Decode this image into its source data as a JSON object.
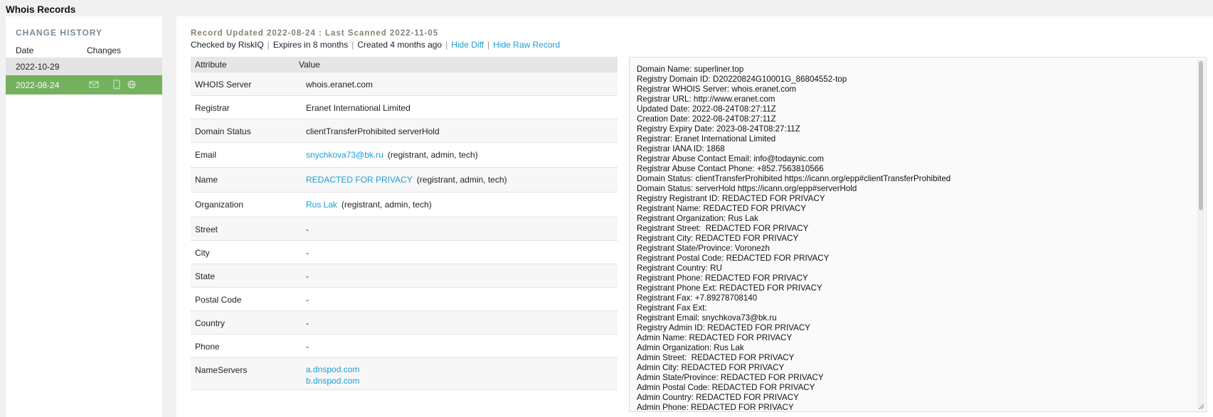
{
  "page": {
    "title": "Whois Records"
  },
  "sidebar": {
    "title": "CHANGE HISTORY",
    "col_date": "Date",
    "col_changes": "Changes",
    "rows": [
      {
        "date": "2022-10-29"
      },
      {
        "date": "2022-08-24",
        "icons": [
          "email-icon",
          "phone-icon",
          "globe-icon"
        ]
      }
    ]
  },
  "record": {
    "header": "Record Updated 2022-08-24 : Last Scanned 2022-11-05",
    "checked_by": "Checked by RiskIQ",
    "expires": "Expires in 8 months",
    "created": "Created 4 months ago",
    "hide_diff": "Hide Diff",
    "hide_raw": "Hide Raw Record"
  },
  "table": {
    "col_attribute": "Attribute",
    "col_value": "Value",
    "rows": [
      {
        "attr": "WHOIS Server",
        "value": "whois.eranet.com"
      },
      {
        "attr": "Registrar",
        "value": "Eranet International Limited"
      },
      {
        "attr": "Domain Status",
        "value": "clientTransferProhibited serverHold"
      },
      {
        "attr": "Email",
        "link": "snychkova73@bk.ru",
        "roles": "(registrant, admin, tech)"
      },
      {
        "attr": "Name",
        "link": "REDACTED FOR PRIVACY",
        "roles": "(registrant, admin, tech)"
      },
      {
        "attr": "Organization",
        "link": "Rus Lak",
        "roles": "(registrant, admin, tech)"
      },
      {
        "attr": "Street",
        "value": "-"
      },
      {
        "attr": "City",
        "value": "-"
      },
      {
        "attr": "State",
        "value": "-"
      },
      {
        "attr": "Postal Code",
        "value": "-"
      },
      {
        "attr": "Country",
        "value": "-"
      },
      {
        "attr": "Phone",
        "value": "-"
      },
      {
        "attr": "NameServers",
        "links": [
          "a.dnspod.com",
          "b.dnspod.com"
        ]
      }
    ]
  },
  "raw_record": {
    "lines": [
      "Domain Name: superliner.top",
      "Registry Domain ID: D20220824G10001G_86804552-top",
      "Registrar WHOIS Server: whois.eranet.com",
      "Registrar URL: http://www.eranet.com",
      "Updated Date: 2022-08-24T08:27:11Z",
      "Creation Date: 2022-08-24T08:27:11Z",
      "Registry Expiry Date: 2023-08-24T08:27:11Z",
      "Registrar: Eranet International Limited",
      "Registrar IANA ID: 1868",
      "Registrar Abuse Contact Email: info@todaynic.com",
      "Registrar Abuse Contact Phone: +852.7563810566",
      "Domain Status: clientTransferProhibited https://icann.org/epp#clientTransferProhibited",
      "Domain Status: serverHold https://icann.org/epp#serverHold",
      "Registry Registrant ID: REDACTED FOR PRIVACY",
      "Registrant Name: REDACTED FOR PRIVACY",
      "Registrant Organization: Rus Lak",
      "Registrant Street:  REDACTED FOR PRIVACY",
      "Registrant City: REDACTED FOR PRIVACY",
      "Registrant State/Province: Voronezh",
      "Registrant Postal Code: REDACTED FOR PRIVACY",
      "Registrant Country: RU",
      "Registrant Phone: REDACTED FOR PRIVACY",
      "Registrant Phone Ext: REDACTED FOR PRIVACY",
      "Registrant Fax: +7.89278708140",
      "Registrant Fax Ext:",
      "Registrant Email: snychkova73@bk.ru",
      "Registry Admin ID: REDACTED FOR PRIVACY",
      "Admin Name: REDACTED FOR PRIVACY",
      "Admin Organization: Rus Lak",
      "Admin Street:  REDACTED FOR PRIVACY",
      "Admin City: REDACTED FOR PRIVACY",
      "Admin State/Province: REDACTED FOR PRIVACY",
      "Admin Postal Code: REDACTED FOR PRIVACY",
      "Admin Country: REDACTED FOR PRIVACY",
      "Admin Phone: REDACTED FOR PRIVACY"
    ]
  },
  "colors": {
    "accent": "#1a9fd6",
    "selected_row": "#73b15e",
    "header_label": "#8a7f70"
  }
}
